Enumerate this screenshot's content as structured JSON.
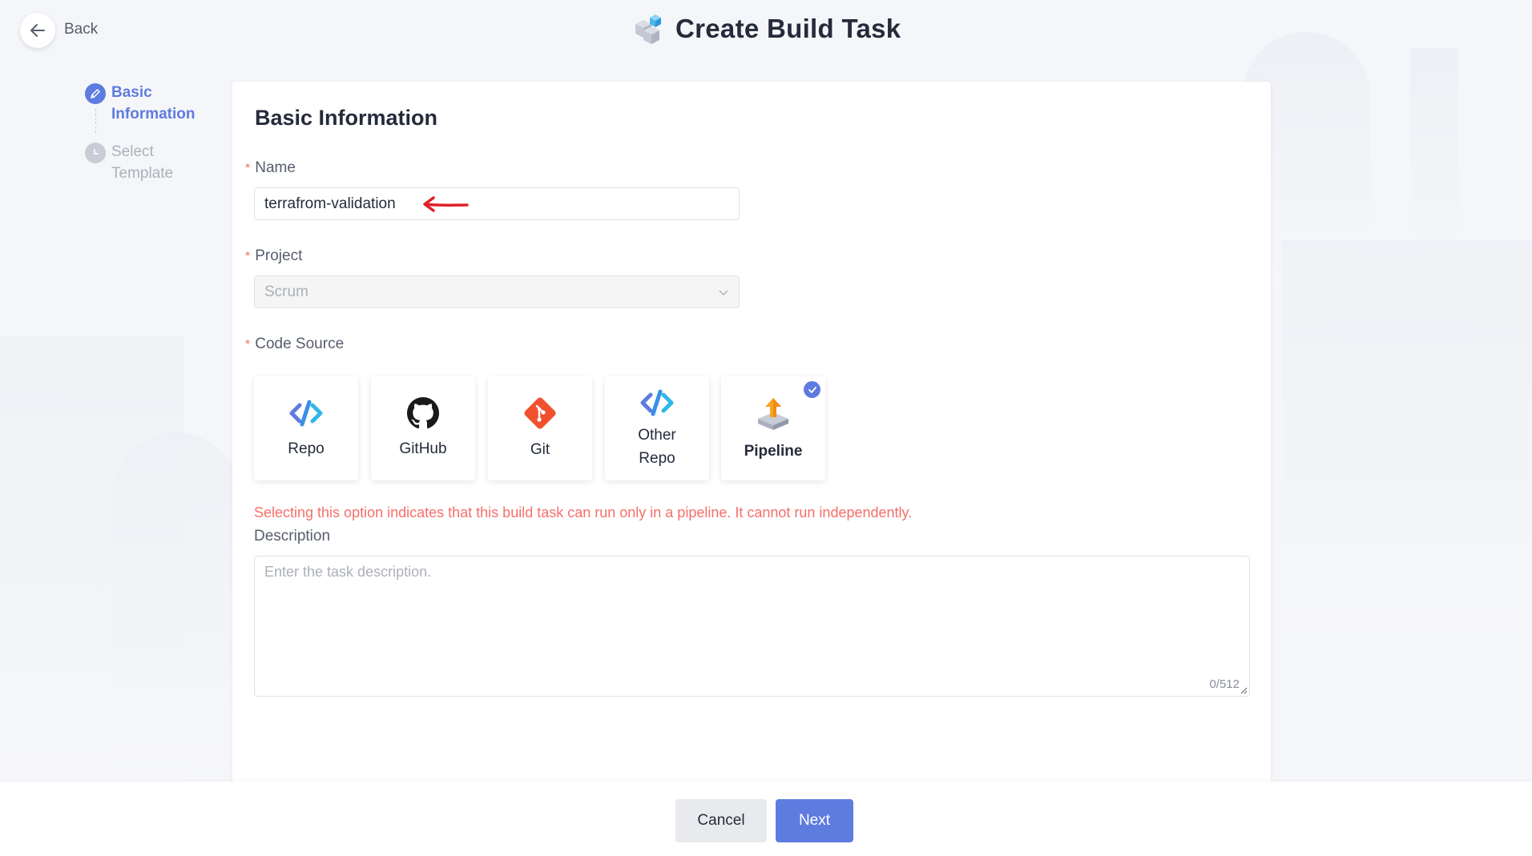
{
  "header": {
    "back_label": "Back",
    "title": "Create Build Task"
  },
  "steps": [
    {
      "label_line1": "Basic",
      "label_line2": "Information",
      "state": "active"
    },
    {
      "label_line1": "Select",
      "label_line2": "Template",
      "state": "todo"
    }
  ],
  "form": {
    "section_title": "Basic Information",
    "required_mark": "*",
    "name": {
      "label": "Name",
      "value": "terrafrom-validation"
    },
    "project": {
      "label": "Project",
      "value": "Scrum"
    },
    "code_source": {
      "label": "Code Source",
      "options": [
        {
          "label": "Repo",
          "icon": "codearts-repo-icon",
          "selected": false
        },
        {
          "label": "GitHub",
          "icon": "github-icon",
          "selected": false
        },
        {
          "label": "Git",
          "icon": "git-icon",
          "selected": false
        },
        {
          "label_line1": "Other",
          "label_line2": "Repo",
          "icon": "other-repo-icon",
          "selected": false
        },
        {
          "label": "Pipeline",
          "icon": "pipeline-icon",
          "selected": true
        }
      ],
      "hint": "Selecting this option indicates that this build task can run only in a pipeline. It cannot run independently."
    },
    "description": {
      "label": "Description",
      "placeholder": "Enter the task description.",
      "counter": "0/512"
    }
  },
  "footer": {
    "cancel_label": "Cancel",
    "next_label": "Next"
  },
  "colors": {
    "primary": "#5e7ce0",
    "error": "#f66f6a",
    "annotation_arrow": "#e0202a"
  }
}
